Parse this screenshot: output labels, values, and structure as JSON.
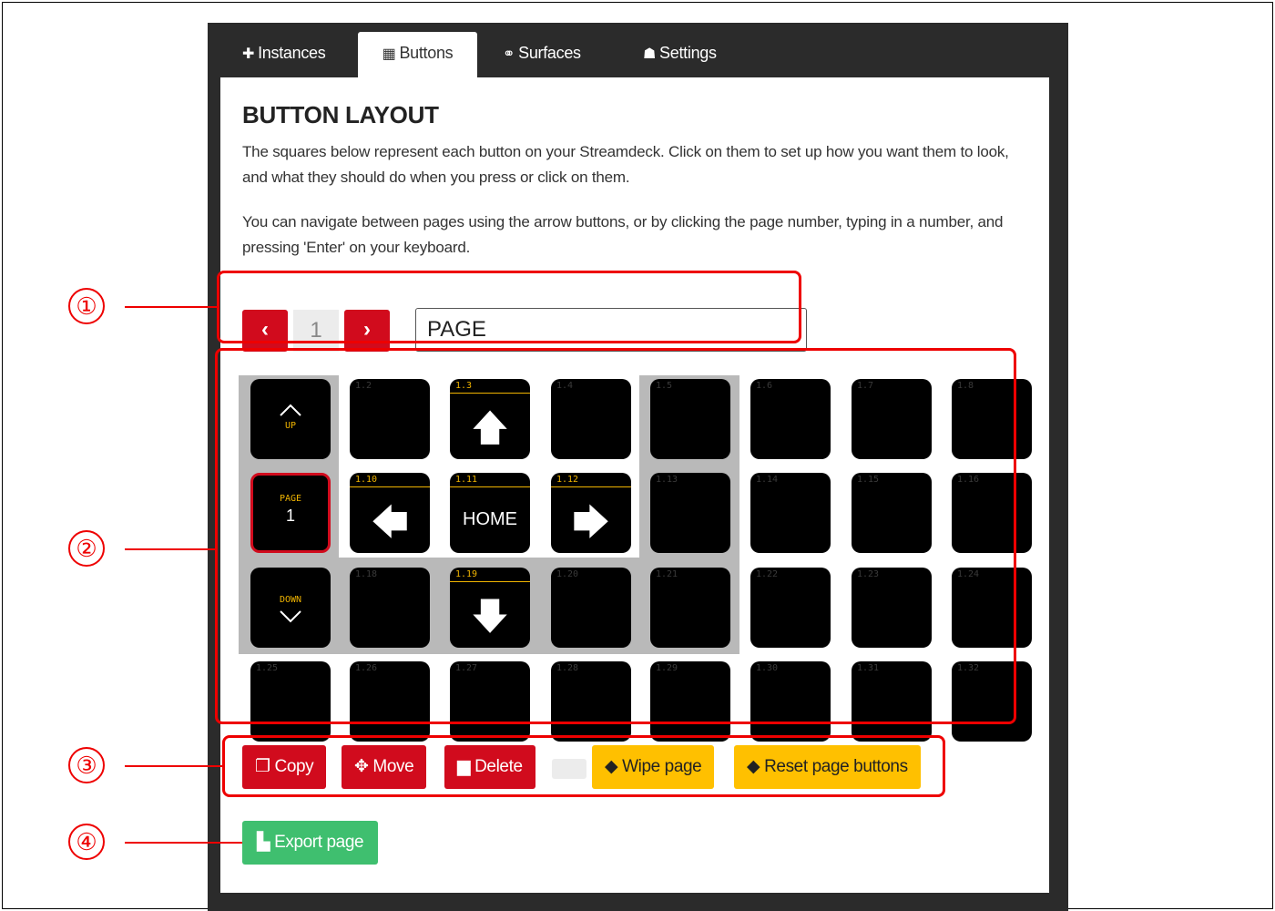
{
  "tabs": [
    {
      "label": "Instances",
      "icon": "plug-icon",
      "glyph": "✚"
    },
    {
      "label": "Buttons",
      "icon": "calendar-grid-icon",
      "glyph": "▦"
    },
    {
      "label": "Surfaces",
      "icon": "gamepad-icon",
      "glyph": "⚭"
    },
    {
      "label": "Settings",
      "icon": "users-cog-icon",
      "glyph": "☗"
    }
  ],
  "section": {
    "title": "BUTTON LAYOUT",
    "para1": "The squares below represent each button on your Streamdeck. Click on them to set up how you want them to look, and what they should do when you press or click on them.",
    "para2": "You can navigate between pages using the arrow buttons, or by clicking the page number, typing in a number, and pressing 'Enter' on your keyboard."
  },
  "pagebar": {
    "prev": "‹",
    "page_number": "1",
    "next": "›",
    "page_name": "PAGE"
  },
  "grid": {
    "buttons": [
      {
        "id": "1.1",
        "kind": "nav-up",
        "text": "UP"
      },
      {
        "id": "1.2"
      },
      {
        "id": "1.3",
        "kind": "arrow-up",
        "hl": true
      },
      {
        "id": "1.4"
      },
      {
        "id": "1.5"
      },
      {
        "id": "1.6"
      },
      {
        "id": "1.7"
      },
      {
        "id": "1.8"
      },
      {
        "id": "1.9",
        "kind": "page",
        "text": "PAGE",
        "value": "1"
      },
      {
        "id": "1.10",
        "kind": "arrow-left",
        "hl": true
      },
      {
        "id": "1.11",
        "kind": "home",
        "text": "HOME",
        "hl": true
      },
      {
        "id": "1.12",
        "kind": "arrow-right",
        "hl": true
      },
      {
        "id": "1.13"
      },
      {
        "id": "1.14"
      },
      {
        "id": "1.15"
      },
      {
        "id": "1.16"
      },
      {
        "id": "1.17",
        "kind": "nav-down",
        "text": "DOWN"
      },
      {
        "id": "1.18"
      },
      {
        "id": "1.19",
        "kind": "arrow-down",
        "hl": true
      },
      {
        "id": "1.20"
      },
      {
        "id": "1.21"
      },
      {
        "id": "1.22"
      },
      {
        "id": "1.23"
      },
      {
        "id": "1.24"
      },
      {
        "id": "1.25"
      },
      {
        "id": "1.26"
      },
      {
        "id": "1.27"
      },
      {
        "id": "1.28"
      },
      {
        "id": "1.29"
      },
      {
        "id": "1.30"
      },
      {
        "id": "1.31"
      },
      {
        "id": "1.32"
      }
    ]
  },
  "actions": {
    "copy": "Copy",
    "move": "Move",
    "delete": "Delete",
    "wipe": "Wipe page",
    "reset": "Reset page buttons"
  },
  "export": {
    "label": "Export page"
  },
  "callouts": [
    "①",
    "②",
    "③",
    "④"
  ],
  "colors": {
    "accent_red": "#d10b1d",
    "warning_yellow": "#ffc000",
    "success_green": "#3fbf6f",
    "annotation_red": "#ee0000"
  }
}
